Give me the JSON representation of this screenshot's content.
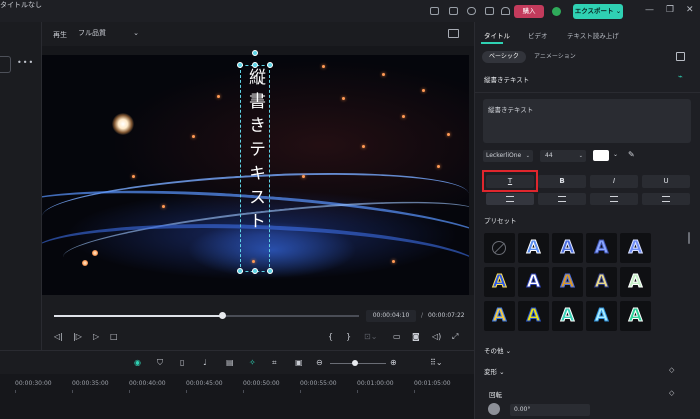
{
  "window": {
    "title": "タイトルなし",
    "buy_label": "購入",
    "export_label": "エクスポート"
  },
  "player": {
    "play_label": "再生",
    "quality": "フル品質",
    "current_time": "00:00:04:10",
    "time_sep": "/",
    "total_time": "00:00:07:22",
    "progress": 0.55,
    "overlay_text": "縦書きテキスト"
  },
  "right": {
    "tabs": [
      "タイトル",
      "ビデオ",
      "テキスト読み上げ"
    ],
    "subtabs": [
      "ベーシック",
      "アニメーション"
    ],
    "section_title": "縦書きテキスト",
    "text_value": "縦書きテキスト",
    "font": "LeckerliOne",
    "size": "44",
    "format_buttons": [
      "T",
      "B",
      "I",
      "U"
    ],
    "preset_label": "プリセット",
    "other_label": "その他",
    "transform_label": "変形",
    "rotate_label": "回転",
    "rotate_value": "0.00°"
  },
  "timeline": {
    "ticks": [
      "00:00:30:00",
      "00:00:35:00",
      "00:00:40:00",
      "00:00:45:00",
      "00:00:50:00",
      "00:00:55:00",
      "00:01:00:00",
      "00:01:05:00"
    ]
  },
  "presets": [
    {
      "fill": "#4a5fd8",
      "stroke": "#ffffff",
      "kind": "none"
    },
    {
      "fill": "#5b8ef0",
      "stroke": "#ffffff"
    },
    {
      "fill": "#4d6fe0",
      "stroke": "#dfe6ff"
    },
    {
      "fill": "#8aa6ff",
      "stroke": "#3c4fa8"
    },
    {
      "fill": "#6f8df5",
      "stroke": "#d8e0ff"
    },
    {
      "fill": "#2b58e8",
      "stroke": "#ffe25a"
    },
    {
      "fill": "#ffffff",
      "stroke": "#2b3fb0"
    },
    {
      "fill": "#d99a2c",
      "stroke": "#4d6fe0"
    },
    {
      "fill": "#e9d98a",
      "stroke": "#2f3c88"
    },
    {
      "fill": "#c7f0c8",
      "stroke": "#ffffff"
    },
    {
      "fill": "#f0c94a",
      "stroke": "#3e7be6"
    },
    {
      "fill": "#e6e020",
      "stroke": "#2452d0"
    },
    {
      "fill": "#3bd2b7",
      "stroke": "#ffffff"
    },
    {
      "fill": "#a7ecff",
      "stroke": "#2f8fd8"
    },
    {
      "fill": "#2fd19a",
      "stroke": "#ffffff"
    }
  ]
}
